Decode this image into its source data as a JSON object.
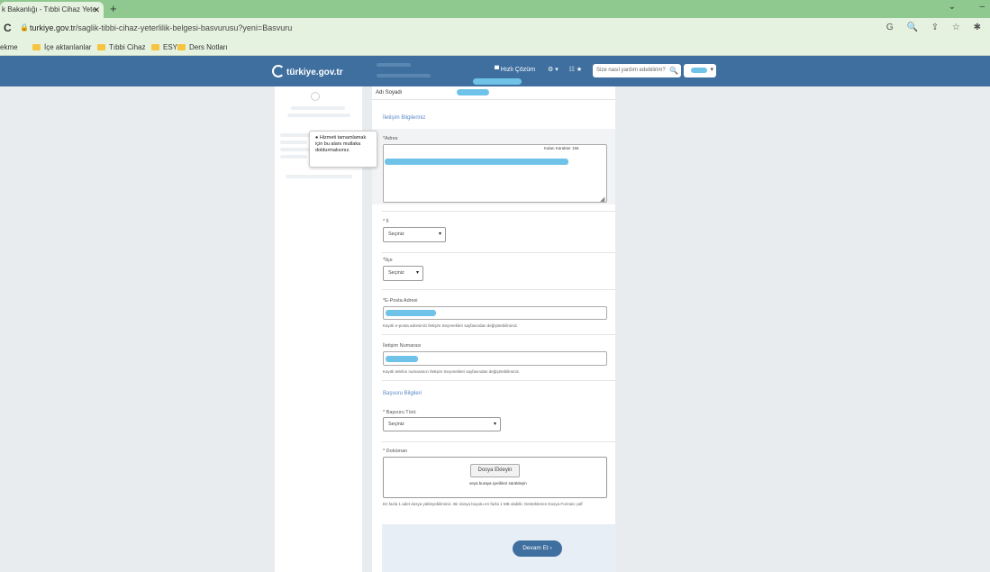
{
  "browser": {
    "tab_title": "k Bakanlığı - Tıbbi Cihaz Yete",
    "tab_close": "✕",
    "new_tab": "+",
    "reload": "C",
    "url_host": "turkiye.gov.tr",
    "url_path": "/saglik-tibbi-cihaz-yeterlilik-belgesi-basvurusu?yeni=Basvuru",
    "addr_icons": "G 🔍 ⇪ ☆ ✱",
    "bookmarks": [
      "ekme",
      "İçe aktarılanlar",
      "Tıbbi Cihaz",
      "ESY",
      "Ders Notları"
    ],
    "win_min": "–",
    "win_chevron": "⌄"
  },
  "header": {
    "logo_text": "türkiye.gov.tr",
    "nav_help": "▀ Hızlı Çözüm",
    "nav_tools": "⚙ ▾",
    "nav_menu": "☷ ★",
    "search_placeholder": "Size nasıl yardım edebilirim?",
    "search_icon": "🔍",
    "user_caret": "▾"
  },
  "form": {
    "name_label": "Adı Soyadı",
    "contact_section": "İletişim Bilgileriniz",
    "address_label": "*Adres",
    "address_counter": "Kalan Karakter 156",
    "city_label": "* İl",
    "city_value": "Seçiniz",
    "district_label": "*İlçe",
    "district_value": "Seçiniz",
    "email_label": "*E-Posta Adresi",
    "email_hint": "Kayıtlı e-posta adresinizi İletişim Seçenekleri sayfasından değiştirebilirsiniz.",
    "phone_label": "İletişim Numarası",
    "phone_hint": "Kayıtlı telefon numaranızı İletişim Seçenekleri sayfasından değiştirebilirsiniz.",
    "application_section": "Başvuru Bilgileri",
    "app_type_label": "* Başvuru Türü",
    "app_type_value": "Seçiniz",
    "document_label": "* Doküman",
    "file_button": "Dosya Ekleyin",
    "drop_text": "veya buraya içerikleri sürükleyin",
    "file_hint": "En fazla 1 adet dosya yükleyebilirsiniz. Bir dosya boyutu en fazla 1 MB olabilir. Desteklenen Dosya Formatı: pdf",
    "submit_button": "Devam Et  ›",
    "caret": "▾"
  },
  "tooltip": {
    "text": "● Hizmeti tamamlamak için bu alanı mutlaka doldurmalısınız."
  }
}
